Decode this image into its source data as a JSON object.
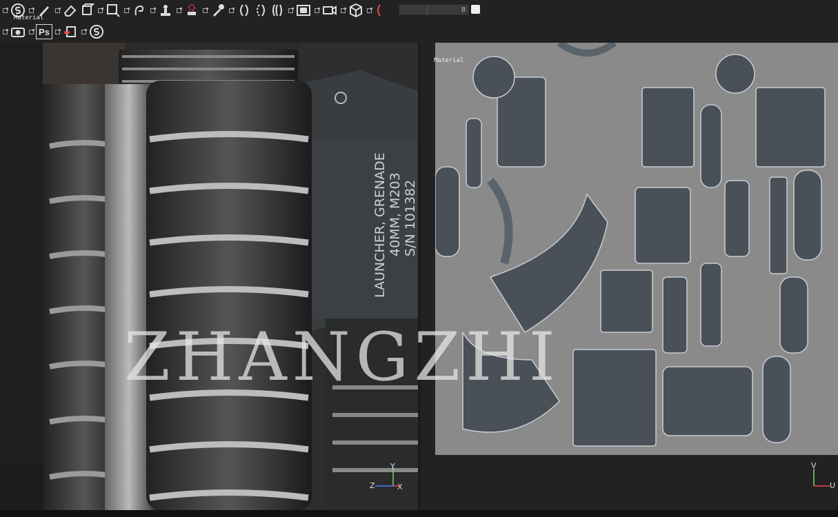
{
  "toolbar": {
    "row1_tools": [
      "substance-logo-icon",
      "paint-brush-icon",
      "eraser-icon",
      "projection-icon",
      "polygon-fill-icon",
      "smudge-icon",
      "clone-icon",
      "clone-stamp-icon",
      "color-picker-icon",
      "symmetry-icon",
      "mirror-icon",
      "x-ray-icon",
      "camera-icon",
      "3d-view-icon",
      "render-icon"
    ],
    "slider_value": "8",
    "row2_tools": [
      "screenshot-icon",
      "photoshop-button",
      "export-icon",
      "substance-share-icon"
    ],
    "photoshop_label": "Ps"
  },
  "viewport3d": {
    "label": "Material",
    "grenade_text": [
      "LAUNCHER, GRENADE",
      "40MM, M203",
      "S/N 101382"
    ],
    "axes": {
      "y": "Y",
      "z": "Z",
      "x": "X"
    }
  },
  "viewport2d": {
    "label": "Material",
    "axes": {
      "v": "V",
      "u": "U"
    }
  },
  "watermark": "ZHANGZHI"
}
